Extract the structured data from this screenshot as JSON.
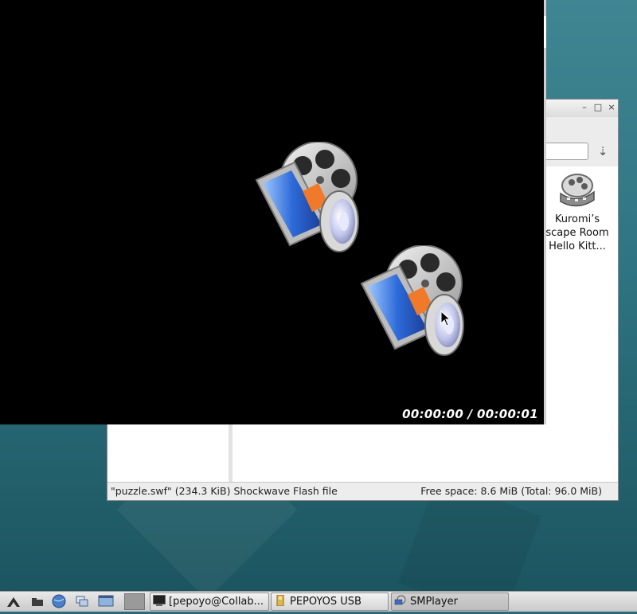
{
  "file_manager": {
    "window_buttons": {
      "minimize": "–",
      "maximize": "□",
      "close": "×"
    },
    "go_icon": "⇣",
    "file": {
      "label": "Kuromi’s\nscape Room\nHello Kitt...",
      "icon": "video-file-icon"
    },
    "status_left": "\"puzzle.swf\" (234.3 KiB) Shockwave Flash file",
    "status_right": "Free space: 8.6 MiB (Total: 96.0 MiB)"
  },
  "player": {
    "time": "00:00:00 / 00:00:01",
    "logos": [
      "smplayer-logo-icon",
      "smplayer-logo-icon"
    ]
  },
  "taskbar": {
    "launchers": [
      "menu-icon",
      "folder-icon",
      "browser-icon",
      "windows-icon",
      "desktop-icon"
    ],
    "tasks": [
      {
        "label": "[pepoyo@Collab...",
        "icon": "terminal-icon"
      },
      {
        "label": "PEPOYOS USB",
        "icon": "folder-icon"
      },
      {
        "label": "SMPlayer",
        "icon": "smplayer-icon"
      }
    ]
  }
}
